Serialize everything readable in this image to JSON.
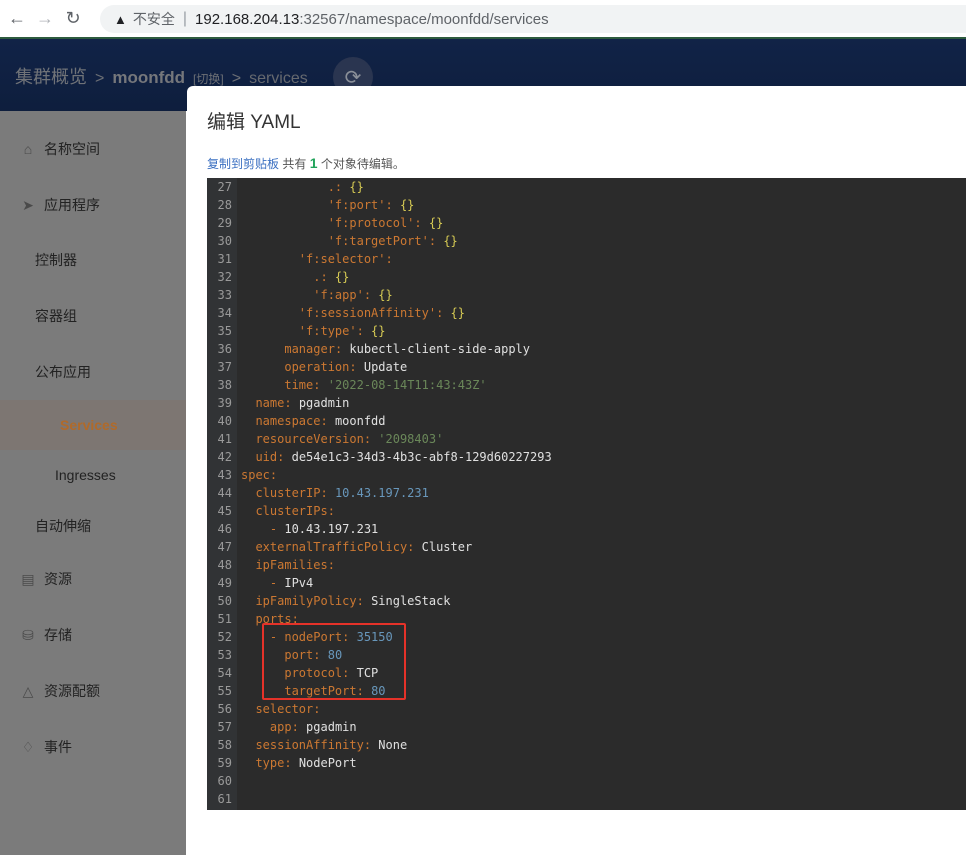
{
  "browser": {
    "security_label": "不安全",
    "url_host": "192.168.204.13",
    "url_rest": ":32567/namespace/moonfdd/services"
  },
  "header": {
    "root": "集群概览",
    "namespace": "moonfdd",
    "switch_label": "[切换]",
    "current": "services"
  },
  "sidebar": {
    "items": [
      {
        "label": "名称空间",
        "icon": "home-icon"
      },
      {
        "label": "应用程序",
        "icon": "paper-plane-icon"
      },
      {
        "label": "控制器"
      },
      {
        "label": "容器组"
      },
      {
        "label": "公布应用"
      },
      {
        "label": "Services",
        "active": true
      },
      {
        "label": "Ingresses"
      },
      {
        "label": "自动伸缩"
      },
      {
        "label": "资源",
        "icon": "box-icon"
      },
      {
        "label": "存储",
        "icon": "database-icon"
      },
      {
        "label": "资源配额",
        "icon": "bell-dome-icon"
      },
      {
        "label": "事件",
        "icon": "bell-icon"
      }
    ]
  },
  "modal": {
    "title": "编辑 YAML",
    "copy_label": "复制到剪贴板",
    "info_prefix": "共有",
    "count": "1",
    "info_suffix": "个对象待编辑。"
  },
  "yaml": {
    "lines": [
      {
        "no": "27",
        "indent": "            ",
        "key": ".:",
        "val": " {}",
        "type": "plainbrace"
      },
      {
        "no": "28",
        "indent": "            ",
        "key": "'f:port'",
        "val": ": {}",
        "type": "qbrace"
      },
      {
        "no": "29",
        "indent": "            ",
        "key": "'f:protocol'",
        "val": ": {}",
        "type": "qbrace"
      },
      {
        "no": "30",
        "indent": "            ",
        "key": "'f:targetPort'",
        "val": ": {}",
        "type": "qbrace"
      },
      {
        "no": "31",
        "indent": "        ",
        "key": "'f:selector'",
        "val": ":",
        "type": "qcolon"
      },
      {
        "no": "32",
        "indent": "          ",
        "key": ".:",
        "val": " {}",
        "type": "plainbrace"
      },
      {
        "no": "33",
        "indent": "          ",
        "key": "'f:app'",
        "val": ": {}",
        "type": "qbrace"
      },
      {
        "no": "34",
        "indent": "        ",
        "key": "'f:sessionAffinity'",
        "val": ": {}",
        "type": "qbrace"
      },
      {
        "no": "35",
        "indent": "        ",
        "key": "'f:type'",
        "val": ": {}",
        "type": "qbrace"
      },
      {
        "no": "36",
        "indent": "      ",
        "key": "manager",
        "val": "kubectl-client-side-apply",
        "type": "kv"
      },
      {
        "no": "37",
        "indent": "      ",
        "key": "operation",
        "val": "Update",
        "type": "kv"
      },
      {
        "no": "38",
        "indent": "      ",
        "key": "time",
        "val": "'2022-08-14T11:43:43Z'",
        "type": "ks"
      },
      {
        "no": "39",
        "indent": "  ",
        "key": "name",
        "val": "pgadmin",
        "type": "kv"
      },
      {
        "no": "40",
        "indent": "  ",
        "key": "namespace",
        "val": "moonfdd",
        "type": "kv"
      },
      {
        "no": "41",
        "indent": "  ",
        "key": "resourceVersion",
        "val": "'2098403'",
        "type": "ks"
      },
      {
        "no": "42",
        "indent": "  ",
        "key": "uid",
        "val": "de54e1c3-34d3-4b3c-abf8-129d60227293",
        "type": "kv"
      },
      {
        "no": "43",
        "indent": "",
        "key": "spec",
        "val": "",
        "type": "k"
      },
      {
        "no": "44",
        "indent": "  ",
        "key": "clusterIP",
        "val": "10.43.197.231",
        "type": "kn"
      },
      {
        "no": "45",
        "indent": "  ",
        "key": "clusterIPs",
        "val": "",
        "type": "k"
      },
      {
        "no": "46",
        "indent": "    ",
        "key": "- ",
        "val": "10.43.197.231",
        "type": "dash"
      },
      {
        "no": "47",
        "indent": "  ",
        "key": "externalTrafficPolicy",
        "val": "Cluster",
        "type": "kv"
      },
      {
        "no": "48",
        "indent": "  ",
        "key": "ipFamilies",
        "val": "",
        "type": "k"
      },
      {
        "no": "49",
        "indent": "    ",
        "key": "- ",
        "val": "IPv4",
        "type": "dash"
      },
      {
        "no": "50",
        "indent": "  ",
        "key": "ipFamilyPolicy",
        "val": "SingleStack",
        "type": "kv"
      },
      {
        "no": "51",
        "indent": "  ",
        "key": "ports",
        "val": "",
        "type": "k"
      },
      {
        "no": "52",
        "indent": "    ",
        "key": "nodePort",
        "val": "35150",
        "type": "dashkn"
      },
      {
        "no": "53",
        "indent": "      ",
        "key": "port",
        "val": "80",
        "type": "kn"
      },
      {
        "no": "54",
        "indent": "      ",
        "key": "protocol",
        "val": "TCP",
        "type": "kv"
      },
      {
        "no": "55",
        "indent": "      ",
        "key": "targetPort",
        "val": "80",
        "type": "kn"
      },
      {
        "no": "56",
        "indent": "  ",
        "key": "selector",
        "val": "",
        "type": "k"
      },
      {
        "no": "57",
        "indent": "    ",
        "key": "app",
        "val": "pgadmin",
        "type": "kv"
      },
      {
        "no": "58",
        "indent": "  ",
        "key": "sessionAffinity",
        "val": "None",
        "type": "kv"
      },
      {
        "no": "59",
        "indent": "  ",
        "key": "type",
        "val": "NodePort",
        "type": "kv"
      },
      {
        "no": "60",
        "indent": "",
        "key": "",
        "val": "",
        "type": "empty"
      },
      {
        "no": "61",
        "indent": "",
        "key": "",
        "val": "",
        "type": "empty"
      }
    ]
  },
  "colors": {
    "header_bg": "#112347",
    "active_nav": "#b06a2a",
    "link": "#3a6fc1",
    "count": "#21a35a",
    "editor_bg": "#2b2b2b",
    "highlight": "#e53229"
  }
}
